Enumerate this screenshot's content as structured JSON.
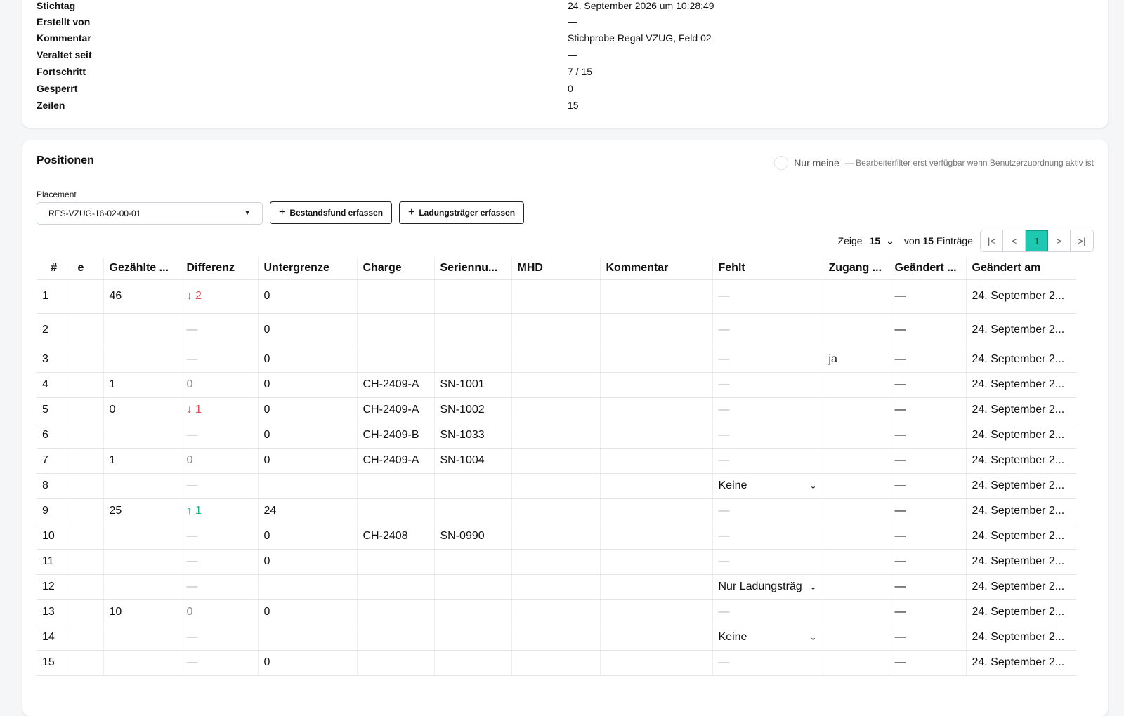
{
  "details": [
    {
      "label": "Stichtag",
      "value": "24. September 2026 um 10:28:49"
    },
    {
      "label": "Erstellt von",
      "value": "—"
    },
    {
      "label": "Kommentar",
      "value": "Stichprobe Regal VZUG, Feld 02"
    },
    {
      "label": "Veraltet seit",
      "value": "—"
    },
    {
      "label": "Fortschritt",
      "value": "7 / 15"
    },
    {
      "label": "Gesperrt",
      "value": "0"
    },
    {
      "label": "Zeilen",
      "value": "15"
    }
  ],
  "positions": {
    "title": "Positionen",
    "only_mine_label": "Nur meine",
    "only_mine_hint": "— Bearbeiterfilter erst verfügbar wenn Benutzerzuordnung aktiv ist",
    "placement_label": "Placement",
    "placement_value": "RES-VZUG-16-02-00-01",
    "add_stock_label": "Bestandsfund erfassen",
    "add_carrier_label": "Ladungsträger erfassen",
    "show_label": "Zeige",
    "page_size": "15",
    "of_label": "von",
    "total": "15",
    "entries_label": "Einträge",
    "pager": {
      "first": "|<",
      "prev": "<",
      "current": "1",
      "next": ">",
      "last": ">|"
    }
  },
  "table": {
    "headers": [
      "#",
      "e",
      "Gezählte ...",
      "Differenz",
      "Untergrenze",
      "Charge",
      "Seriennu...",
      "MHD",
      "Kommentar",
      "Fehlt",
      "Zugang ...",
      "Geändert ...",
      "Geändert am"
    ],
    "rows": [
      {
        "n": "1",
        "counted": "46",
        "diff": "↓ 2",
        "diff_type": "down",
        "lower": "0",
        "charge": "",
        "serial": "",
        "missing": "—",
        "missing_select": false,
        "access": "",
        "changed_by": "—",
        "changed_at": "24. September 2..."
      },
      {
        "n": "2",
        "counted": "",
        "diff": "—",
        "diff_type": "none",
        "lower": "0",
        "charge": "",
        "serial": "",
        "missing": "—",
        "missing_select": false,
        "access": "",
        "changed_by": "—",
        "changed_at": "24. September 2..."
      },
      {
        "n": "3",
        "counted": "",
        "diff": "—",
        "diff_type": "none",
        "lower": "0",
        "charge": "",
        "serial": "",
        "missing": "—",
        "missing_select": false,
        "access": "ja",
        "changed_by": "—",
        "changed_at": "24. September 2..."
      },
      {
        "n": "4",
        "counted": "1",
        "diff": "0",
        "diff_type": "zero",
        "lower": "0",
        "charge": "CH-2409-A",
        "serial": "SN-1001",
        "missing": "—",
        "missing_select": false,
        "access": "",
        "changed_by": "—",
        "changed_at": "24. September 2..."
      },
      {
        "n": "5",
        "counted": "0",
        "diff": "↓ 1",
        "diff_type": "down",
        "lower": "0",
        "charge": "CH-2409-A",
        "serial": "SN-1002",
        "missing": "—",
        "missing_select": false,
        "access": "",
        "changed_by": "—",
        "changed_at": "24. September 2..."
      },
      {
        "n": "6",
        "counted": "",
        "diff": "—",
        "diff_type": "none",
        "lower": "0",
        "charge": "CH-2409-B",
        "serial": "SN-1033",
        "missing": "—",
        "missing_select": false,
        "access": "",
        "changed_by": "—",
        "changed_at": "24. September 2..."
      },
      {
        "n": "7",
        "counted": "1",
        "diff": "0",
        "diff_type": "zero",
        "lower": "0",
        "charge": "CH-2409-A",
        "serial": "SN-1004",
        "missing": "—",
        "missing_select": false,
        "access": "",
        "changed_by": "—",
        "changed_at": "24. September 2..."
      },
      {
        "n": "8",
        "counted": "",
        "diff": "—",
        "diff_type": "none",
        "lower": "",
        "charge": "",
        "serial": "",
        "missing": "Keine",
        "missing_select": true,
        "access": "",
        "changed_by": "—",
        "changed_at": "24. September 2..."
      },
      {
        "n": "9",
        "counted": "25",
        "diff": "↑ 1",
        "diff_type": "up",
        "lower": "24",
        "charge": "",
        "serial": "",
        "missing": "—",
        "missing_select": false,
        "access": "",
        "changed_by": "—",
        "changed_at": "24. September 2..."
      },
      {
        "n": "10",
        "counted": "",
        "diff": "—",
        "diff_type": "none",
        "lower": "0",
        "charge": "CH-2408",
        "serial": "SN-0990",
        "missing": "—",
        "missing_select": false,
        "access": "",
        "changed_by": "—",
        "changed_at": "24. September 2..."
      },
      {
        "n": "11",
        "counted": "",
        "diff": "—",
        "diff_type": "none",
        "lower": "0",
        "charge": "",
        "serial": "",
        "missing": "—",
        "missing_select": false,
        "access": "",
        "changed_by": "—",
        "changed_at": "24. September 2..."
      },
      {
        "n": "12",
        "counted": "",
        "diff": "—",
        "diff_type": "none",
        "lower": "",
        "charge": "",
        "serial": "",
        "missing": "Nur Ladungsträg",
        "missing_select": true,
        "access": "",
        "changed_by": "—",
        "changed_at": "24. September 2..."
      },
      {
        "n": "13",
        "counted": "10",
        "diff": "0",
        "diff_type": "zero",
        "lower": "0",
        "charge": "",
        "serial": "",
        "missing": "—",
        "missing_select": false,
        "access": "",
        "changed_by": "—",
        "changed_at": "24. September 2..."
      },
      {
        "n": "14",
        "counted": "",
        "diff": "—",
        "diff_type": "none",
        "lower": "",
        "charge": "",
        "serial": "",
        "missing": "Keine",
        "missing_select": true,
        "access": "",
        "changed_by": "—",
        "changed_at": "24. September 2..."
      },
      {
        "n": "15",
        "counted": "",
        "diff": "—",
        "diff_type": "none",
        "lower": "0",
        "charge": "",
        "serial": "",
        "missing": "—",
        "missing_select": false,
        "access": "",
        "changed_by": "—",
        "changed_at": "24. September 2..."
      }
    ]
  },
  "colors": {
    "accent": "#1fc8b0",
    "diff_down": "#e5484d",
    "diff_up": "#12b886"
  }
}
